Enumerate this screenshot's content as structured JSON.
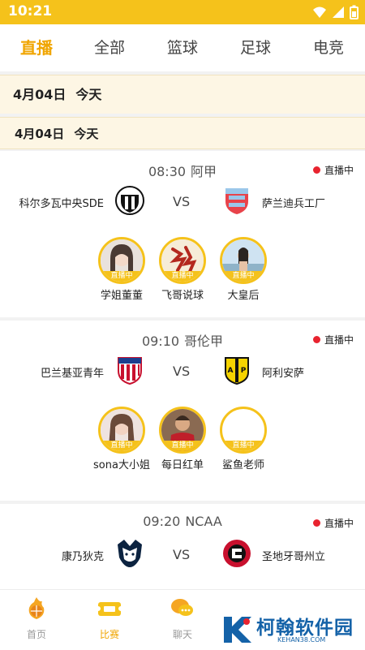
{
  "status_bar": {
    "time": "10:21"
  },
  "tabs": [
    "直播",
    "全部",
    "篮球",
    "足球",
    "电竞"
  ],
  "date_header": {
    "date": "4月04日",
    "day": "今天"
  },
  "date_subheader": {
    "date": "4月04日",
    "day": "今天"
  },
  "matches": [
    {
      "time": "08:30",
      "league": "阿甲",
      "status": "直播中",
      "home": "科尔多瓦中央SDE",
      "away": "萨兰迪兵工厂",
      "vs": "VS",
      "anchors": [
        {
          "name": "学姐董董",
          "badge": "直播中"
        },
        {
          "name": "飞哥说球",
          "badge": "直播中"
        },
        {
          "name": "大皇后",
          "badge": "直播中"
        }
      ]
    },
    {
      "time": "09:10",
      "league": "哥伦甲",
      "status": "直播中",
      "home": "巴兰基亚青年",
      "away": "阿利安萨",
      "vs": "VS",
      "anchors": [
        {
          "name": "sona大小姐",
          "badge": "直播中"
        },
        {
          "name": "每日红单",
          "badge": "直播中"
        },
        {
          "name": "鲨鱼老师",
          "badge": "直播中"
        }
      ]
    },
    {
      "time": "09:20",
      "league": "NCAA",
      "status": "直播中",
      "home": "康乃狄克",
      "away": "圣地牙哥州立",
      "vs": "VS"
    }
  ],
  "bottom_nav": [
    {
      "label": "首页",
      "icon": "basketball-fire-icon"
    },
    {
      "label": "比赛",
      "icon": "match-ticket-icon"
    },
    {
      "label": "聊天",
      "icon": "chat-bubbles-icon"
    }
  ],
  "watermark": {
    "name": "柯翰软件园",
    "url": "KEHAN38.COM"
  },
  "colors": {
    "accent": "#f5c21b",
    "active_tab": "#f0a500",
    "live_dot": "#e8232f"
  }
}
